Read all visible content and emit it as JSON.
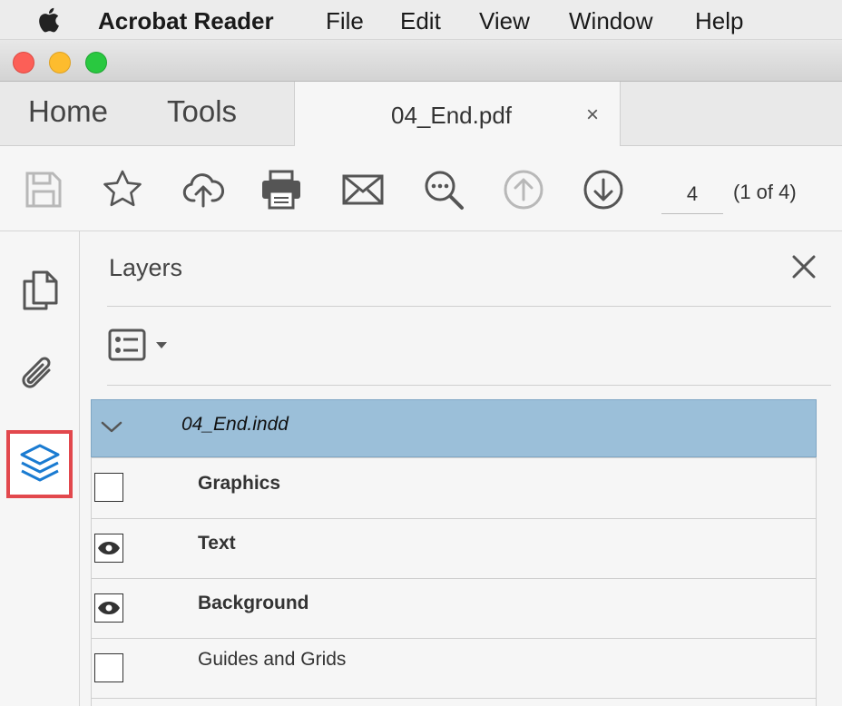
{
  "menubar": {
    "app_name": "Acrobat Reader",
    "items": [
      "File",
      "Edit",
      "View",
      "Window",
      "Help"
    ]
  },
  "tabs": {
    "home_label": "Home",
    "tools_label": "Tools",
    "document_title": "04_End.pdf",
    "close_glyph": "×"
  },
  "toolbar": {
    "icons": [
      "save-icon",
      "bookmark-star-icon",
      "upload-cloud-icon",
      "print-icon",
      "email-icon",
      "find-text-icon",
      "previous-page-icon",
      "next-page-icon"
    ],
    "page_number": "4",
    "page_count": "(1 of 4)"
  },
  "rail": {
    "icons": [
      "page-thumbnails-icon",
      "attachments-icon",
      "layers-icon"
    ],
    "selected": "layers-icon",
    "selection_color": "#e2484d"
  },
  "panel": {
    "title": "Layers",
    "options_icon": "layer-options-icon"
  },
  "layers": {
    "root": "04_End.indd",
    "root_highlight": "#9bbfd9",
    "items": [
      {
        "name": "Graphics",
        "visible": false,
        "bold": true
      },
      {
        "name": "Text",
        "visible": true,
        "bold": true
      },
      {
        "name": "Background",
        "visible": true,
        "bold": true
      },
      {
        "name": "Guides and Grids",
        "visible": false,
        "bold": false
      }
    ]
  }
}
